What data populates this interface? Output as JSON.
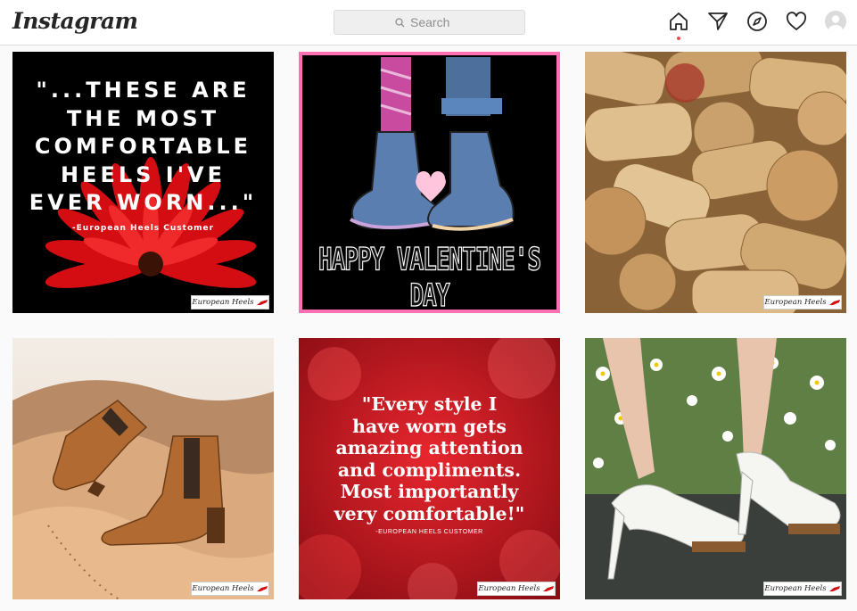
{
  "app": {
    "logo": "Instagram"
  },
  "search": {
    "placeholder": "Search"
  },
  "nav": {
    "icons": [
      "home-icon",
      "direct-icon",
      "explore-icon",
      "activity-icon",
      "profile-avatar"
    ],
    "active": "home-icon"
  },
  "posts": [
    {
      "quote": "\"...THESE ARE\nTHE MOST\nCOMFORTABLE\nHEELS I'VE\nEVER WORN...\"",
      "attribution": "-European Heels Customer",
      "brand": "European Heels"
    },
    {
      "caption": "HAPPY VALENTINE'S DAY"
    },
    {
      "brand": "European Heels"
    },
    {
      "brand": "European Heels"
    },
    {
      "quote": "\"Every style I\nhave worn gets\namazing attention\nand compliments.\nMost importantly\nvery comfortable!\"",
      "attribution": "-EUROPEAN HEELS CUSTOMER",
      "brand": "European Heels"
    },
    {
      "brand": "European Heels"
    }
  ],
  "colors": {
    "accent": "#ed4956",
    "border": "#dbdbdb",
    "valentine_frame": "#ff6fb3"
  }
}
